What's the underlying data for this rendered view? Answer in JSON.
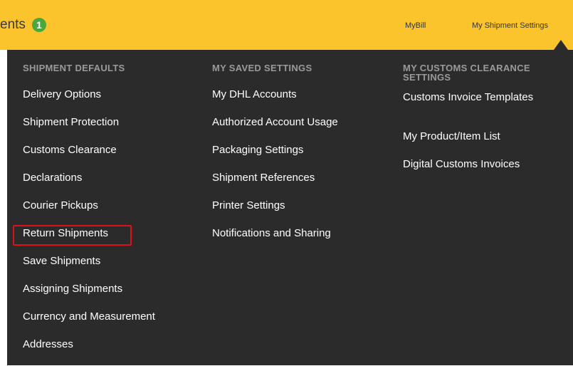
{
  "topbar": {
    "title": "ents",
    "badge_count": "1",
    "links": [
      "MyBill",
      "My Shipment Settings"
    ]
  },
  "menu": {
    "columns": [
      {
        "heading": "SHIPMENT DEFAULTS",
        "items": [
          "Delivery Options",
          "Shipment Protection",
          "Customs Clearance",
          "Declarations",
          "Courier Pickups",
          "Return Shipments",
          "Save Shipments",
          "Assigning Shipments",
          "Currency and Measurement",
          "Addresses"
        ]
      },
      {
        "heading": "MY SAVED SETTINGS",
        "items": [
          "My DHL Accounts",
          "Authorized Account Usage",
          "Packaging Settings",
          "Shipment References",
          "Printer Settings",
          "Notifications and Sharing"
        ]
      },
      {
        "heading": "MY CUSTOMS CLEARANCE SETTINGS",
        "items": [
          "Customs Invoice Templates",
          "My Product/Item List",
          "Digital Customs Invoices"
        ]
      }
    ],
    "highlighted_item": "Return Shipments"
  },
  "colors": {
    "topbar_bg": "#fcc42c",
    "panel_bg": "#2b2b2b",
    "badge_bg": "#4aa63f",
    "highlight_border": "#e0101a"
  }
}
